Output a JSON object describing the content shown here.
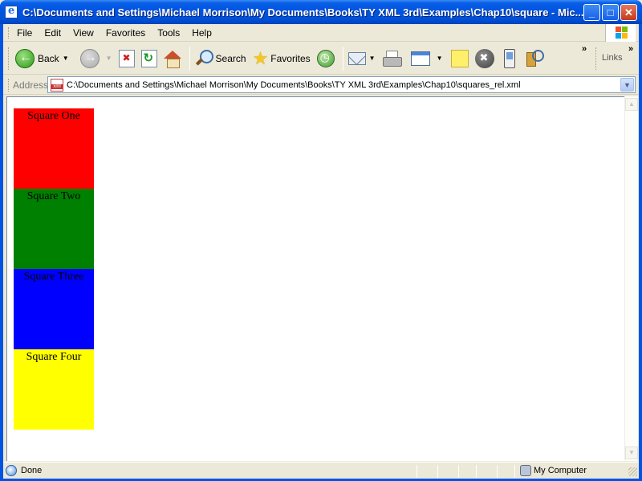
{
  "window": {
    "title": "C:\\Documents and Settings\\Michael Morrison\\My Documents\\Books\\TY XML 3rd\\Examples\\Chap10\\square - Mic...",
    "minimize": "_",
    "maximize": "□",
    "close": "✕"
  },
  "menu": {
    "items": [
      "File",
      "Edit",
      "View",
      "Favorites",
      "Tools",
      "Help"
    ]
  },
  "toolbar": {
    "back_label": "Back",
    "search_label": "Search",
    "favorites_label": "Favorites",
    "links_label": "Links",
    "overflow": "»"
  },
  "address": {
    "label": "Address",
    "url": "C:\\Documents and Settings\\Michael Morrison\\My Documents\\Books\\TY XML 3rd\\Examples\\Chap10\\squares_rel.xml"
  },
  "squares": [
    {
      "label": "Square One",
      "color": "#ff0000"
    },
    {
      "label": "Square Two",
      "color": "#008000"
    },
    {
      "label": "Square Three",
      "color": "#0000ff"
    },
    {
      "label": "Square Four",
      "color": "#ffff00"
    }
  ],
  "status": {
    "text": "Done",
    "zone": "My Computer"
  }
}
